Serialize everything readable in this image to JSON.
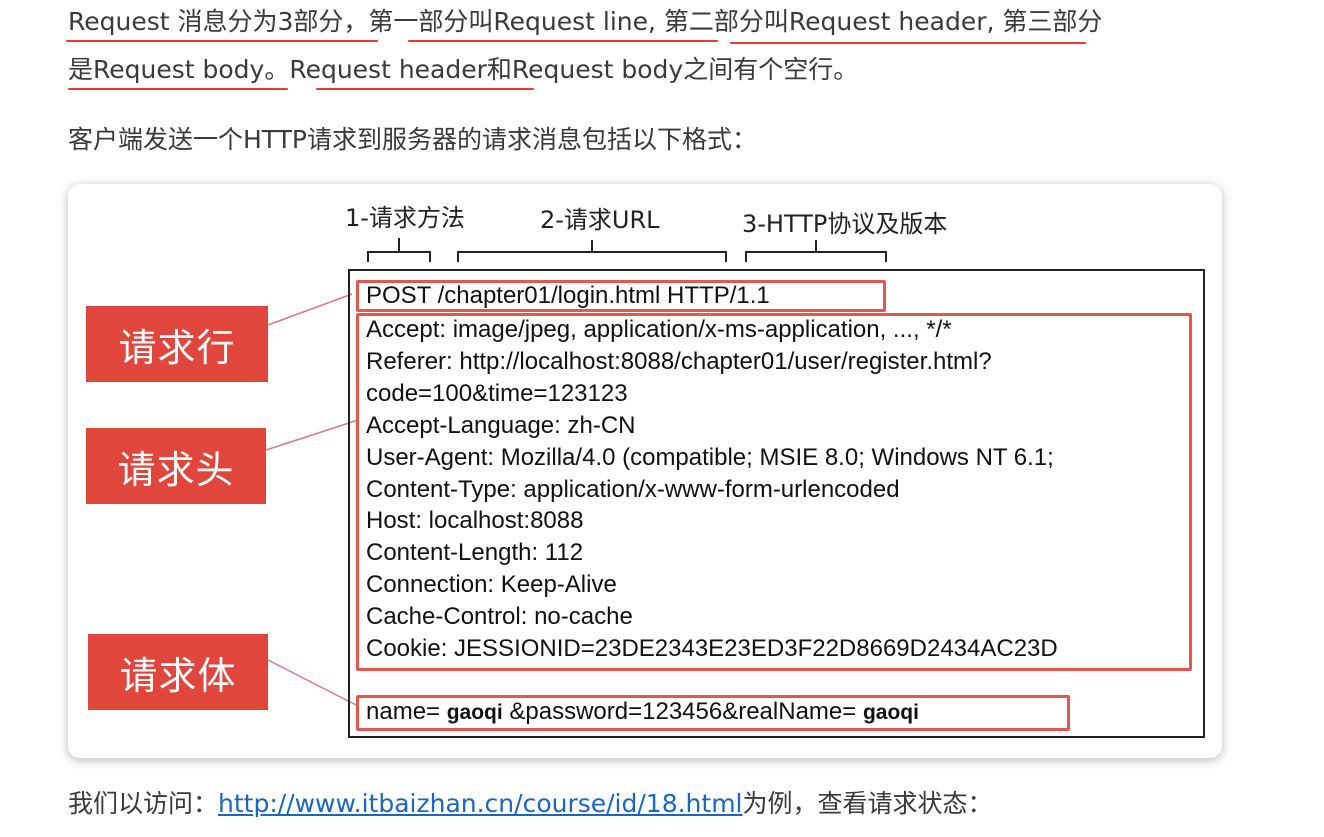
{
  "intro": {
    "line1": "Request 消息分为3部分，第一部分叫Request line, 第二部分叫Request header, 第三部分",
    "line2": "是Request body。Request header和Request body之间有个空行。",
    "line3": "客户端发送一个HTTP请求到服务器的请求消息包括以下格式："
  },
  "diagram": {
    "top_labels": {
      "method": "1-请求方法",
      "url": "2-请求URL",
      "protocol": "3-HTTP协议及版本"
    },
    "side_labels": {
      "request_line": "请求行",
      "request_header": "请求头",
      "request_body": "请求体"
    },
    "request_line": "POST  /chapter01/login.html  HTTP/1.1",
    "headers": [
      "Accept: image/jpeg, application/x-ms-application, ..., */*",
      "Referer: http://localhost:8088/chapter01/user/register.html?",
      "code=100&time=123123",
      "Accept-Language: zh-CN",
      "User-Agent: Mozilla/4.0 (compatible; MSIE 8.0; Windows NT 6.1;",
      "Content-Type: application/x-www-form-urlencoded",
      "Host: localhost:8088",
      "Content-Length: 112",
      "Connection: Keep-Alive",
      "Cache-Control: no-cache",
      "Cookie: JESSIONID=23DE2343E23ED3F22D8669D2434AC23D"
    ],
    "body": {
      "prefix": "name= ",
      "name_value": "gaoqi",
      "middle": " &password=123456&realName= ",
      "realname_value": "gaoqi"
    }
  },
  "footer": {
    "prefix": "我们以访问：",
    "link": "http://www.itbaizhan.cn/course/id/18.html",
    "suffix": "为例，查看请求状态："
  },
  "colors": {
    "accent_red": "#e0463c",
    "link_blue": "#1a66c4"
  }
}
